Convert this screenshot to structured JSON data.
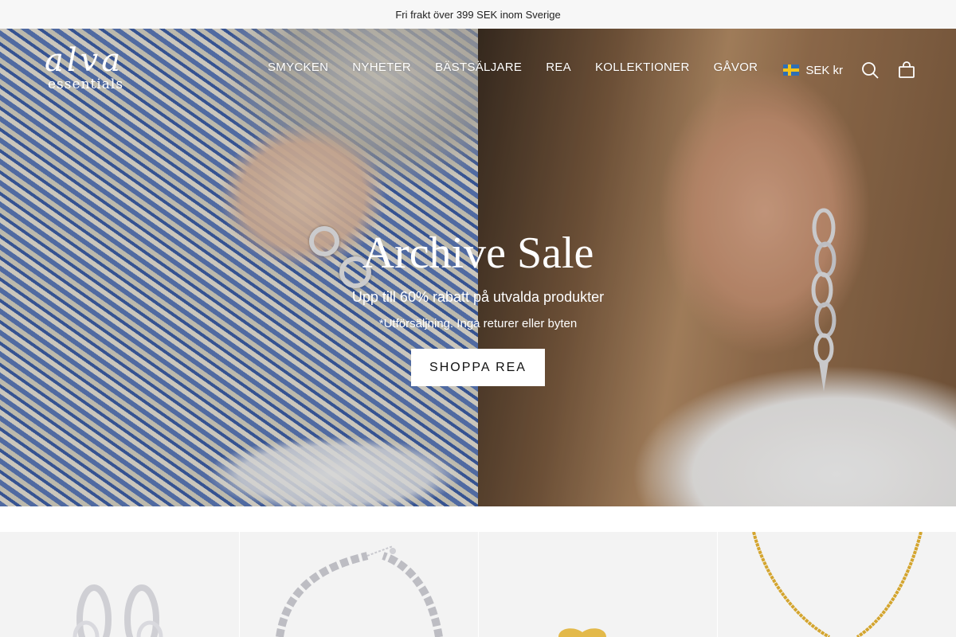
{
  "announcement": "Fri frakt över 399 SEK inom Sverige",
  "logo": {
    "line1": "alva",
    "line2": "essentials"
  },
  "nav": [
    {
      "label": "SMYCKEN"
    },
    {
      "label": "NYHETER"
    },
    {
      "label": "BÄSTSÄLJARE"
    },
    {
      "label": "REA"
    },
    {
      "label": "KOLLEKTIONER"
    },
    {
      "label": "GÅVOR"
    }
  ],
  "currency": {
    "label": "SEK kr"
  },
  "icons": {
    "search": "search-icon",
    "cart": "bag-icon",
    "flag": "sweden-flag-icon"
  },
  "hero": {
    "title": "Archive Sale",
    "subtitle": "Upp till 60% rabatt på utvalda produkter",
    "note": "*Utförsäljning. Inga returer eller byten",
    "cta": "SHOPPA REA"
  },
  "products": [
    {
      "item": "silver hoop earrings"
    },
    {
      "item": "silver chain bracelet"
    },
    {
      "item": "gold heart ring"
    },
    {
      "item": "gold chain necklace"
    }
  ],
  "colors": {
    "accent": "#ffffff",
    "announcement_bg": "#f7f7f7",
    "product_bg": "#f3f3f3"
  }
}
